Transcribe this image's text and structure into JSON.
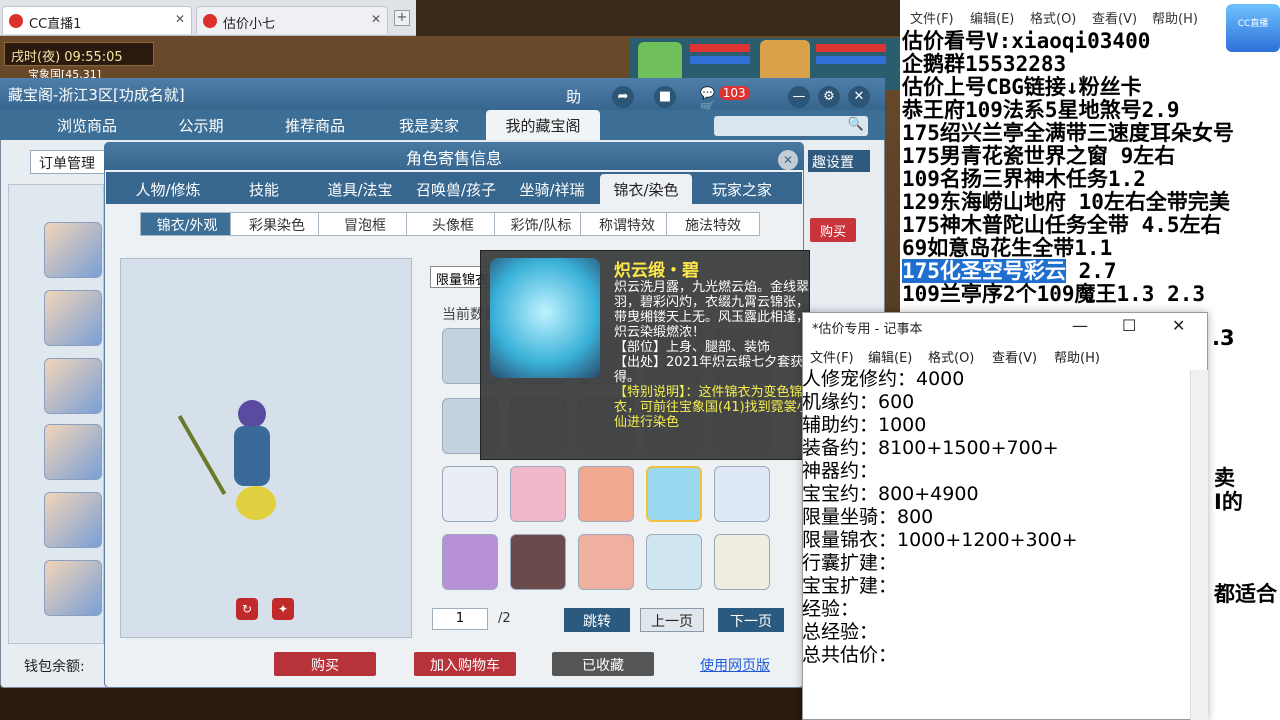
{
  "browser": {
    "tabs": [
      {
        "label": "CC直播1"
      },
      {
        "label": "估价小七"
      }
    ],
    "new_tab": "+"
  },
  "hud": {
    "time": "戌时(夜)  09:55:05",
    "map": "宝象国[45,31]"
  },
  "cbg": {
    "title": "藏宝阁-浙江3区[功成名就]",
    "help": "助",
    "cart_count": "103",
    "tabs": [
      "浏览商品",
      "公示期",
      "推荐商品",
      "我是卖家",
      "我的藏宝阁"
    ],
    "order_mgmt": "订单管理",
    "fav_settings": "趣设置",
    "side_buy": "购买",
    "wallet": "钱包余额:"
  },
  "dialog": {
    "title": "角色寄售信息",
    "tabs": [
      "人物/修炼",
      "技能",
      "道具/法宝",
      "召唤兽/孩子",
      "坐骑/祥瑞",
      "锦衣/染色",
      "玩家之家"
    ],
    "subtabs": [
      "锦衣/外观",
      "彩果染色",
      "冒泡框",
      "头像框",
      "彩饰/队标",
      "称谓特效",
      "施法特效"
    ],
    "limit_label": "限量锦衣",
    "current_label": "当前数量",
    "pager": {
      "page": "1",
      "total": "/2",
      "jump": "跳转",
      "prev": "上一页",
      "next": "下一页"
    },
    "actions": {
      "buy": "购买",
      "add_cart": "加入购物车",
      "collected": "已收藏",
      "web": "使用网页版"
    }
  },
  "tooltip": {
    "title": "炽云缎・碧",
    "desc": "炽云洗月露，九光燃云焰。金线翠羽，碧彩闪灼，衣缀九霄云锦张，带曳缃镂天上无。风玉露此相逢，炽云染缎燃浓！",
    "part": "【部位】上身、腿部、装饰",
    "source": "【出处】2021年炽云缎七夕套获得。",
    "special_label": "【特别说明】：",
    "special": "这件锦衣为变色锦衣，可前往宝象国(41)找到霓裳小仙进行染色"
  },
  "notepad_bg": {
    "menu": [
      "文件(F)",
      "编辑(E)",
      "格式(O)",
      "查看(V)",
      "帮助(H)"
    ],
    "lines": [
      "估价看号V:xiaoqi03400",
      "企鹅群15532283",
      "估价上号CBG链接↓粉丝卡",
      "恭王府109法系5星地煞号2.9",
      "175绍兴兰亭全满带三速度耳朵女号",
      "175男青花瓷世界之窗  9左右",
      "109名扬三界神木任务1.2",
      "129东海崂山地府 10左右全带完美",
      "175神木普陀山任务全带 4.5左右",
      "69如意岛花生全带1.1",
      "175化圣空号彩云",
      "109兰亭序2个109魔王1.3 2.3"
    ],
    "highlight_suffix": " 2.7",
    "partial_right": [
      ".3",
      "卖",
      "I的",
      "都适合"
    ]
  },
  "notepad": {
    "title": "*估价专用 - 记事本",
    "menu": [
      "文件(F)",
      "编辑(E)",
      "格式(O)",
      "查看(V)",
      "帮助(H)"
    ],
    "lines": [
      "人修宠修约：4000",
      "机缘约：600",
      "辅助约：1000",
      "装备约：8100+1500+700+",
      "神器约：",
      "宝宝约：800+4900",
      "限量坐骑：800",
      "限量锦衣：1000+1200+300+",
      "行囊扩建：",
      "宝宝扩建：",
      "经验：",
      "总经验：",
      "总共估价："
    ]
  }
}
